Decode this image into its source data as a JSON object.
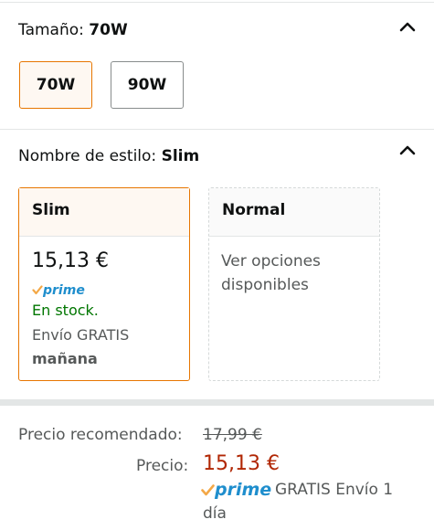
{
  "size": {
    "label": "Tamaño:",
    "selected": "70W",
    "options": [
      {
        "label": "70W",
        "selected": true
      },
      {
        "label": "90W",
        "selected": false
      }
    ]
  },
  "style": {
    "label": "Nombre de estilo:",
    "selected": "Slim",
    "cards": [
      {
        "name": "Slim",
        "price": "15,13 €",
        "prime": "prime",
        "stock": "En stock.",
        "shipping": "Envío GRATIS",
        "delivery": "mañana"
      },
      {
        "name": "Normal",
        "options_text": "Ver opciones disponibles"
      }
    ]
  },
  "pricing": {
    "recommended_label": "Precio recomendado:",
    "recommended_value": "17,99 €",
    "price_label": "Precio:",
    "price_value": "15,13 €",
    "prime": "prime",
    "free_shipping": "GRATIS Envío 1",
    "free_shipping_day": "día"
  },
  "colors": {
    "accent_orange": "#e77600",
    "price_red": "#b12704",
    "stock_green": "#007600",
    "prime_blue": "#1f8ecd",
    "prime_check": "#f3a847"
  },
  "icons": {
    "collapse": "chevron-up-icon",
    "prime_check": "prime-check-icon"
  }
}
